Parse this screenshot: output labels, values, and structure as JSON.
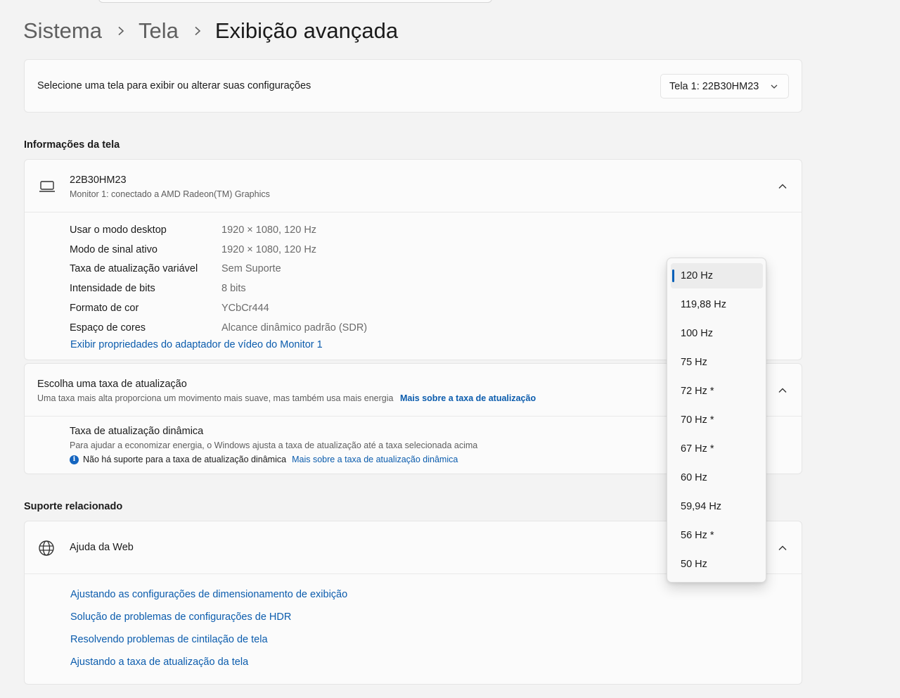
{
  "breadcrumb": {
    "items": [
      "Sistema",
      "Tela"
    ],
    "current": "Exibição avançada"
  },
  "display_select": {
    "label": "Selecione uma tela para exibir ou alterar suas configurações",
    "selected": "Tela 1: 22B30HM23"
  },
  "display_info": {
    "section_title": "Informações da tela",
    "monitor_name": "22B30HM23",
    "monitor_subtitle": "Monitor 1: conectado a AMD Radeon(TM) Graphics",
    "rows": [
      {
        "label": "Usar o modo desktop",
        "value": "1920 × 1080, 120 Hz"
      },
      {
        "label": "Modo de sinal ativo",
        "value": "1920 × 1080, 120 Hz"
      },
      {
        "label": "Taxa de atualização variável",
        "value": "Sem Suporte"
      },
      {
        "label": "Intensidade de bits",
        "value": "8 bits"
      },
      {
        "label": "Formato de cor",
        "value": "YCbCr444"
      },
      {
        "label": "Espaço de cores",
        "value": "Alcance dinâmico padrão (SDR)"
      }
    ],
    "adapter_link": "Exibir propriedades do adaptador de vídeo do Monitor 1"
  },
  "refresh_rate": {
    "title": "Escolha uma taxa de atualização",
    "subtitle": "Uma taxa mais alta proporciona um movimento mais suave, mas também usa mais energia",
    "learn_more": "Mais sobre a taxa de atualização",
    "dynamic_title": "Taxa de atualização dinâmica",
    "dynamic_subtitle": "Para ajudar a economizar energia, o Windows ajusta a taxa de atualização até a taxa selecionada acima",
    "dynamic_note": "Não há suporte para a taxa de atualização dinâmica",
    "dynamic_learn_more": "Mais sobre a taxa de atualização dinâmica",
    "options": [
      "120 Hz",
      "119,88 Hz",
      "100 Hz",
      "75 Hz",
      "72 Hz *",
      "70 Hz *",
      "67 Hz *",
      "60 Hz",
      "59,94 Hz",
      "56 Hz *",
      "50 Hz"
    ],
    "selected": "120 Hz"
  },
  "related_support": {
    "section_title": "Suporte relacionado",
    "web_help_title": "Ajuda da Web",
    "links": [
      "Ajustando as configurações de dimensionamento de exibição",
      "Solução de problemas de configurações de HDR",
      "Resolvendo problemas de cintilação de tela",
      "Ajustando a taxa de atualização da tela"
    ]
  },
  "colors": {
    "background": "#f3f3f3",
    "card": "#fbfbfb",
    "link": "#0b5cad",
    "accent": "#005fb8"
  }
}
